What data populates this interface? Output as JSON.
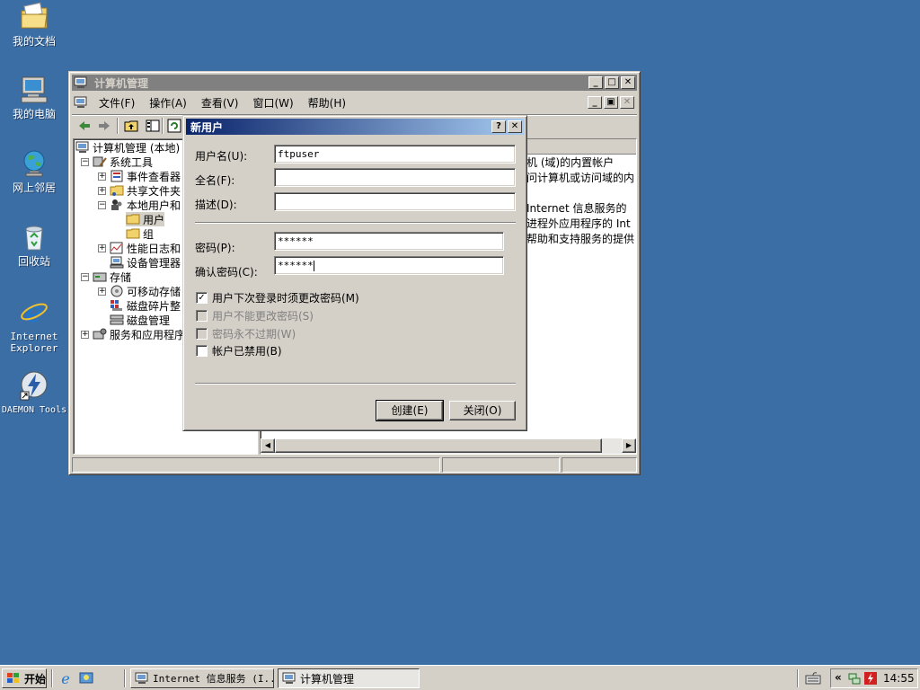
{
  "desktop": {
    "icons": [
      {
        "label": "我的文档"
      },
      {
        "label": "我的电脑"
      },
      {
        "label": "网上邻居"
      },
      {
        "label": "回收站"
      },
      {
        "label": "Internet Explorer"
      },
      {
        "label": "DAEMON Tools"
      }
    ]
  },
  "main_window": {
    "title": "计算机管理",
    "menu": [
      "文件(F)",
      "操作(A)",
      "查看(V)",
      "窗口(W)",
      "帮助(H)"
    ],
    "tree": [
      {
        "label": "计算机管理 (本地)",
        "expander": ""
      },
      {
        "label": "系统工具",
        "expander": "−"
      },
      {
        "label": "事件查看器",
        "expander": "+"
      },
      {
        "label": "共享文件夹",
        "expander": "+"
      },
      {
        "label": "本地用户和",
        "expander": "−"
      },
      {
        "label": "用户",
        "expander": ""
      },
      {
        "label": "组",
        "expander": ""
      },
      {
        "label": "性能日志和",
        "expander": "+"
      },
      {
        "label": "设备管理器",
        "expander": ""
      },
      {
        "label": "存储",
        "expander": "−"
      },
      {
        "label": "可移动存储",
        "expander": "+"
      },
      {
        "label": "磁盘碎片整",
        "expander": ""
      },
      {
        "label": "磁盘管理",
        "expander": ""
      },
      {
        "label": "服务和应用程序",
        "expander": "+"
      }
    ],
    "right_pane_lines": [
      "机 (域)的内置帐户",
      "问计算机或访问域的内",
      "",
      "Internet 信息服务的",
      "进程外应用程序的 Int",
      "帮助和支持服务的提供"
    ]
  },
  "dialog": {
    "title": "新用户",
    "fields": {
      "username_label": "用户名(U):",
      "username_value": "ftpuser",
      "fullname_label": "全名(F):",
      "fullname_value": "",
      "desc_label": "描述(D):",
      "desc_value": "",
      "password_label": "密码(P):",
      "password_value": "******",
      "confirm_label": "确认密码(C):",
      "confirm_value": "******"
    },
    "checkboxes": [
      {
        "label": "用户下次登录时须更改密码(M)",
        "checked": true,
        "enabled": true
      },
      {
        "label": "用户不能更改密码(S)",
        "checked": false,
        "enabled": false
      },
      {
        "label": "密码永不过期(W)",
        "checked": false,
        "enabled": false
      },
      {
        "label": "帐户已禁用(B)",
        "checked": false,
        "enabled": true
      }
    ],
    "buttons": {
      "create": "创建(E)",
      "close": "关闭(O)"
    }
  },
  "taskbar": {
    "start_label": "开始",
    "tasks": [
      {
        "label": "Internet 信息服务 (I..."
      },
      {
        "label": "计算机管理"
      }
    ],
    "tray_chevron": "«",
    "clock": "14:55"
  },
  "colors": {
    "desktop": "#3a6ea5",
    "active_title_start": "#0a246a",
    "active_title_end": "#a6caf0",
    "inactive_title": "#808080",
    "face": "#d4d0c8"
  }
}
